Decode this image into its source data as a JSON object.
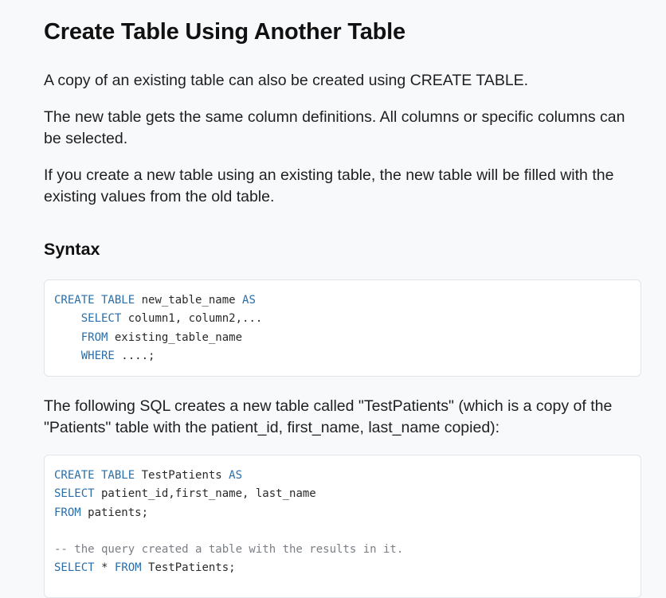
{
  "heading": "Create Table Using Another Table",
  "paragraphs": {
    "p1": "A copy of an existing table can also be created using CREATE TABLE.",
    "p2": "The new table gets the same column definitions. All columns or specific columns can be selected.",
    "p3": "If you create a new table using an existing table, the new table will be filled with the existing values from the old table.",
    "p4": "The following SQL creates a new table called \"TestPatients\" (which is a copy of the \"Patients\" table with the patient_id, first_name, last_name copied):"
  },
  "syntax_heading": "Syntax",
  "syntax_code": {
    "l1_kw": "CREATE TABLE",
    "l1_rest": " new_table_name ",
    "l1_kw2": "AS",
    "l2_indent": "    ",
    "l2_kw": "SELECT",
    "l2_rest": " column1, column2,...",
    "l3_indent": "    ",
    "l3_kw": "FROM",
    "l3_rest": " existing_table_name",
    "l4_indent": "    ",
    "l4_kw": "WHERE",
    "l4_rest": " ....;"
  },
  "example_code": {
    "l1_kw": "CREATE TABLE",
    "l1_rest": " TestPatients ",
    "l1_kw2": "AS",
    "l2_kw": "SELECT",
    "l2_rest": " patient_id,first_name, last_name",
    "l3_kw": "FROM",
    "l3_rest": " patients;",
    "l5_comment": "-- the query created a table with the results in it.",
    "l6_kw": "SELECT",
    "l6_rest": " * ",
    "l6_kw2": "FROM",
    "l6_rest2": " TestPatients;"
  },
  "colors": {
    "background": "#f8f9fb",
    "keyword": "#2b6ea8",
    "comment": "#7a7f86",
    "code_background": "#ffffff"
  }
}
